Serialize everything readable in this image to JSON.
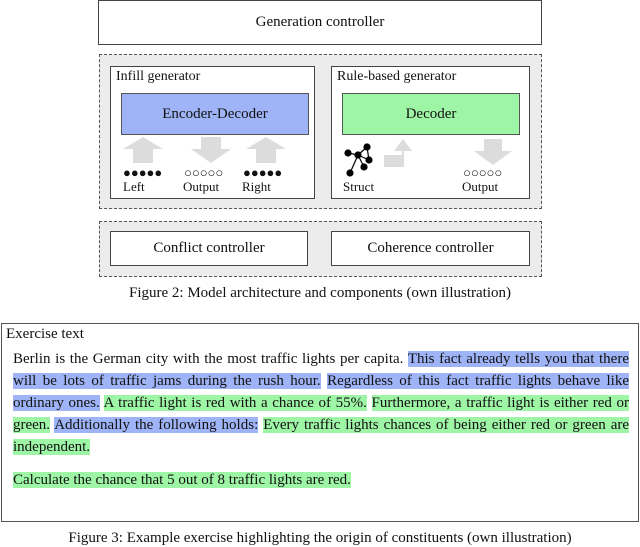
{
  "figure2": {
    "generation_controller": "Generation controller",
    "infill": {
      "title": "Infill generator",
      "block": "Encoder-Decoder",
      "block_color": "#9fb4f6",
      "inputs": [
        {
          "label": "Left",
          "dots": "●●●●●",
          "direction": "up"
        },
        {
          "label": "Output",
          "dots": "○○○○○",
          "direction": "down"
        },
        {
          "label": "Right",
          "dots": "●●●●●",
          "direction": "up"
        }
      ]
    },
    "rule_based": {
      "title": "Rule-based generator",
      "block": "Decoder",
      "block_color": "#9ff5a6",
      "struct_label": "Struct",
      "output_label": "Output",
      "output_dots": "○○○○○"
    },
    "conflict_controller": "Conflict controller",
    "coherence_controller": "Coherence controller",
    "caption": "Figure 2: Model architecture and components (own illustration)"
  },
  "figure3": {
    "title": "Exercise text",
    "paragraphs": [
      [
        {
          "text": "Berlin is the German city with the most traffic lights per capita.",
          "source": "none"
        },
        {
          "text": " ",
          "source": "none"
        },
        {
          "text": "This fact already tells you that there will be lots of traffic jams during the rush hour.",
          "source": "infill"
        },
        {
          "text": " ",
          "source": "none"
        },
        {
          "text": "Regardless of this fact traffic lights behave like ordinary ones.",
          "source": "infill"
        },
        {
          "text": " ",
          "source": "none"
        },
        {
          "text": "A traffic light is red with a chance of 55%.",
          "source": "rule"
        },
        {
          "text": " ",
          "source": "none"
        },
        {
          "text": "Furthermore, a traffic light is either red or green.",
          "source": "rule"
        },
        {
          "text": " ",
          "source": "none"
        },
        {
          "text": "Additionally the following holds:",
          "source": "infill"
        },
        {
          "text": " ",
          "source": "none"
        },
        {
          "text": "Every traffic lights chances of being either red or green are independent.",
          "source": "rule"
        }
      ],
      [
        {
          "text": "Calculate the chance that 5 out of 8 traffic lights are red.",
          "source": "rule"
        }
      ]
    ],
    "highlight_colors": {
      "infill": "#9fb4f6",
      "rule": "#9ff5a6"
    },
    "caption": "Figure 3: Example exercise highlighting the origin of constituents (own illustration)"
  }
}
